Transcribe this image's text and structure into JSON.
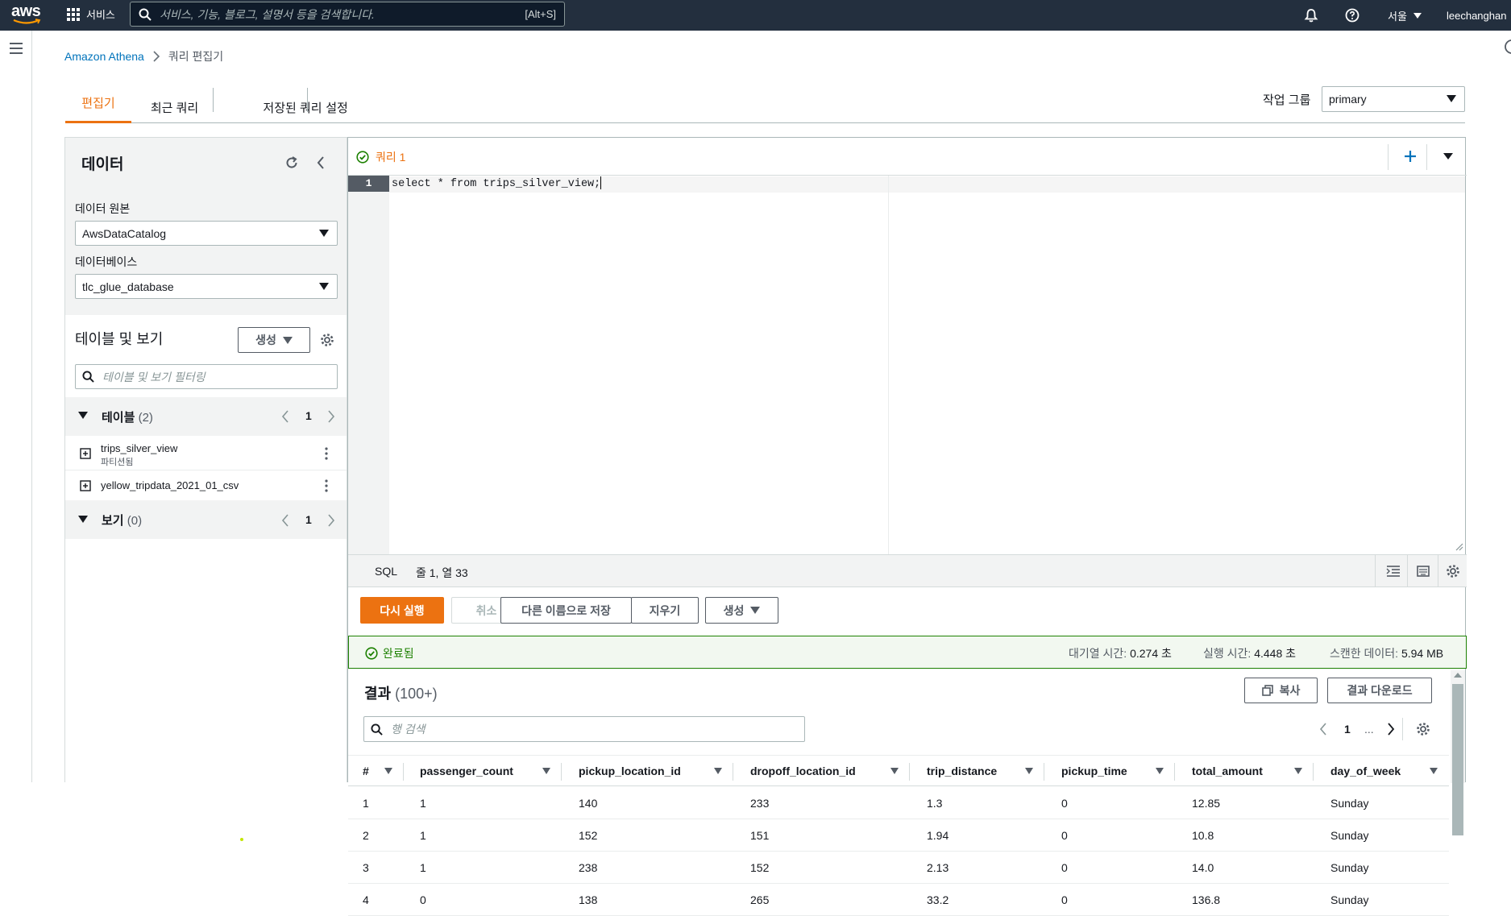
{
  "topnav": {
    "logo_text": "aws",
    "services_label": "서비스",
    "search_placeholder": "서비스, 기능, 블로그, 설명서 등을 검색합니다.",
    "search_shortcut": "[Alt+S]",
    "region": "서울",
    "user": "leechanghan"
  },
  "breadcrumb": {
    "root": "Amazon Athena",
    "current": "쿼리 편집기"
  },
  "tabs": [
    {
      "label": "편집기"
    },
    {
      "label": "최근 쿼리"
    },
    {
      "label": "저장된 쿼리"
    },
    {
      "label": "설정"
    }
  ],
  "workgroup": {
    "label": "작업 그룹",
    "value": "primary"
  },
  "data_panel": {
    "title": "데이터",
    "source_label": "데이터 원본",
    "source_value": "AwsDataCatalog",
    "database_label": "데이터베이스",
    "database_value": "tlc_glue_database",
    "tables_views_title": "테이블 및 보기",
    "create_label": "생성",
    "filter_placeholder": "테이블 및 보기 필터링",
    "tables_label": "테이블",
    "tables_count": "(2)",
    "tables_page": "1",
    "tables": [
      {
        "name": "trips_silver_view",
        "sub": "파티션됨"
      },
      {
        "name": "yellow_tripdata_2021_01_csv",
        "sub": ""
      }
    ],
    "views_label": "보기",
    "views_count": "(0)",
    "views_page": "1"
  },
  "editor": {
    "query_tab": "쿼리 1",
    "line_number": "1",
    "code": "select * from trips_silver_view;",
    "lang": "SQL",
    "cursor_pos": "줄 1, 열 33"
  },
  "actions": {
    "run_again": "다시 실행",
    "cancel": "취소",
    "save_as": "다른 이름으로 저장",
    "clear": "지우기",
    "create": "생성"
  },
  "status": {
    "state": "완료됨",
    "queue_label": "대기열 시간:",
    "queue_value": "0.274 초",
    "run_label": "실행 시간:",
    "run_value": "4.448 초",
    "scan_label": "스캔한 데이터:",
    "scan_value": "5.94 MB"
  },
  "results": {
    "title": "결과",
    "count": "(100+)",
    "copy": "복사",
    "download": "결과 다운로드",
    "search_placeholder": "행 검색",
    "page": "1",
    "ellipsis": "...",
    "columns": [
      "#",
      "passenger_count",
      "pickup_location_id",
      "dropoff_location_id",
      "trip_distance",
      "pickup_time",
      "total_amount",
      "day_of_week"
    ],
    "rows": [
      [
        "1",
        "1",
        "140",
        "233",
        "1.3",
        "0",
        "12.85",
        "Sunday"
      ],
      [
        "2",
        "1",
        "152",
        "151",
        "1.94",
        "0",
        "10.8",
        "Sunday"
      ],
      [
        "3",
        "1",
        "238",
        "152",
        "2.13",
        "0",
        "14.0",
        "Sunday"
      ],
      [
        "4",
        "0",
        "138",
        "265",
        "33.2",
        "0",
        "136.8",
        "Sunday"
      ]
    ]
  },
  "colors": {
    "nav_bg": "#232f3e",
    "accent": "#ec7211",
    "link": "#0073bb",
    "success": "#1d8102"
  }
}
